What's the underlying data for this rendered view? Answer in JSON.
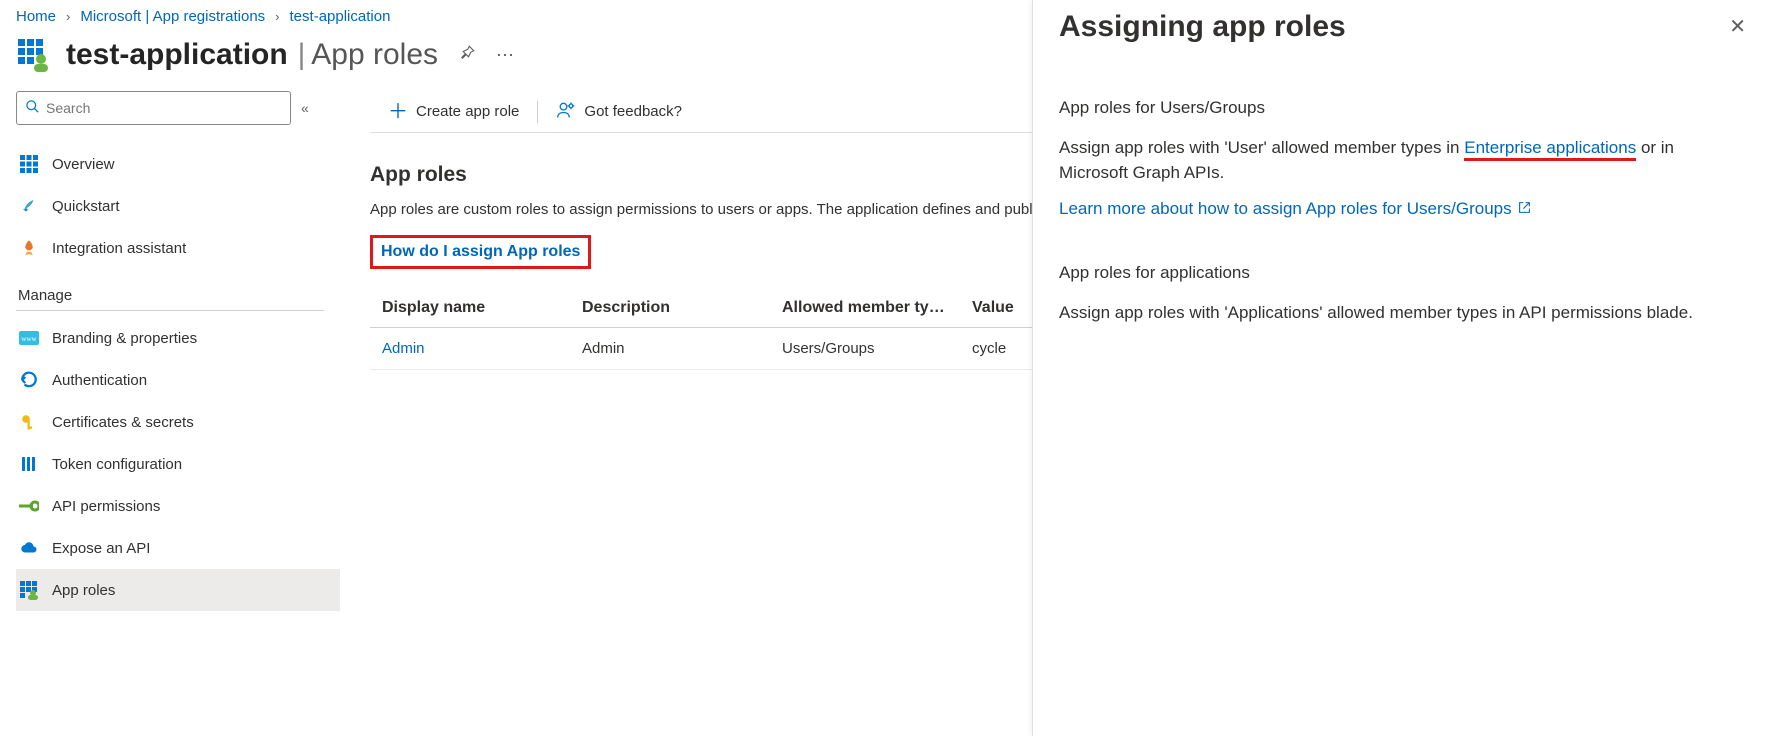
{
  "breadcrumb": {
    "items": [
      "Home",
      "Microsoft | App registrations",
      "test-application"
    ]
  },
  "header": {
    "app_name": "test-application",
    "section": "App roles"
  },
  "search": {
    "placeholder": "Search"
  },
  "sidebar": {
    "items": [
      {
        "label": "Overview"
      },
      {
        "label": "Quickstart"
      },
      {
        "label": "Integration assistant"
      }
    ],
    "manage_label": "Manage",
    "manage_items": [
      {
        "label": "Branding & properties"
      },
      {
        "label": "Authentication"
      },
      {
        "label": "Certificates & secrets"
      },
      {
        "label": "Token configuration"
      },
      {
        "label": "API permissions"
      },
      {
        "label": "Expose an API"
      },
      {
        "label": "App roles"
      }
    ]
  },
  "toolbar": {
    "create": "Create app role",
    "feedback": "Got feedback?"
  },
  "content": {
    "title": "App roles",
    "description": "App roles are custom roles to assign permissions to users or apps. The application defines and publishes the app roles and interprets them as permissions during authorization.",
    "assign_link": "How do I assign App roles",
    "columns": {
      "name": "Display name",
      "desc": "Description",
      "member": "Allowed member ty…",
      "value": "Value"
    },
    "rows": [
      {
        "name": "Admin",
        "desc": "Admin",
        "member": "Users/Groups",
        "value": "cycle"
      }
    ]
  },
  "panel": {
    "title": "Assigning app roles",
    "users_heading": "App roles for Users/Groups",
    "users_text_pre": "Assign app roles with 'User' allowed member types in ",
    "users_link": "Enterprise applications",
    "users_text_post": " or in Microsoft Graph APIs.",
    "learn_more": "Learn more about how to assign App roles for Users/Groups",
    "apps_heading": "App roles for applications",
    "apps_text": "Assign app roles with 'Applications' allowed member types in API permissions blade."
  }
}
